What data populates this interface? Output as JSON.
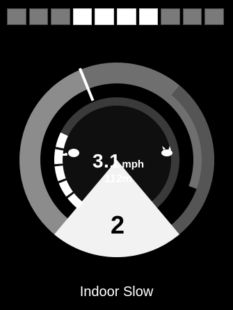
{
  "battery": {
    "segments": [
      {
        "filled": false
      },
      {
        "filled": false
      },
      {
        "filled": false
      },
      {
        "filled": true
      },
      {
        "filled": true
      },
      {
        "filled": true
      },
      {
        "filled": true
      },
      {
        "filled": false
      },
      {
        "filled": false
      },
      {
        "filled": false
      }
    ],
    "colors": {
      "filled": "#ffffff",
      "empty": "#7a7a7a"
    }
  },
  "gauge": {
    "speed_value": "3.1",
    "speed_unit": "mph",
    "distance": "112m",
    "profile_number": "2",
    "icons": {
      "slow": "turtle-icon",
      "fast": "hare-icon"
    },
    "colors": {
      "outer_left": "#8c8c8c",
      "outer_right": "#6f6f6f",
      "ring_dark": "#3a3a3a",
      "needle": "#ffffff",
      "bottom_sector": "#f2f2f2",
      "inner_disk": "#0f0f0f"
    }
  },
  "footer": {
    "profile_name": "Indoor Slow"
  }
}
